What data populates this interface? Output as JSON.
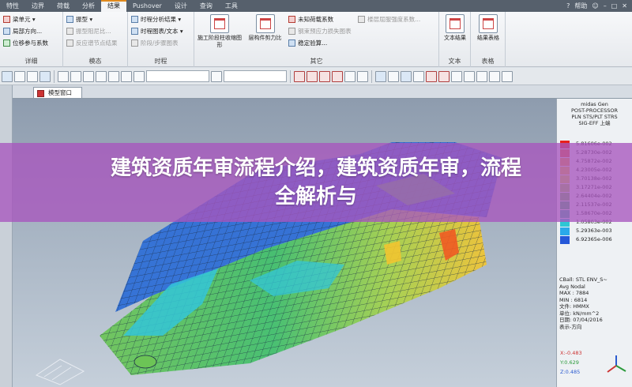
{
  "tabs": [
    "特性",
    "边界",
    "荷载",
    "分析",
    "结果",
    "Pushover",
    "设计",
    "查询",
    "工具"
  ],
  "active_tab": "结果",
  "topbar": {
    "help_label": "帮助",
    "icons": [
      "help-icon",
      "user-icon",
      "minimize-icon",
      "restore-icon",
      "close-icon"
    ]
  },
  "ribbon": {
    "groups": [
      {
        "title": "详细",
        "items": [
          "梁单元 ▾",
          "局部方向...",
          "位移参与系数"
        ]
      },
      {
        "title": "模态",
        "items": [
          "振型 ▾",
          "振型阻尼比...",
          "反应谱节点结果"
        ]
      },
      {
        "title": "时程",
        "items": [
          "时程分析结果 ▾",
          "时程图表/文本 ▾",
          "阶段/步骤图表"
        ]
      },
      {
        "title": "其它",
        "big": [
          "施工阶段柱收缩图形",
          "层构件剪力比"
        ],
        "items": [
          "未知荷载系数",
          "钢束预应力损失图表",
          "稳定验算...",
          "楼层屈服强度系数..."
        ]
      },
      {
        "title": "文本",
        "big": [
          "文本结果"
        ]
      },
      {
        "title": "表格",
        "big": [
          "结果表格"
        ]
      }
    ]
  },
  "model_window": {
    "tab_label": "模型窗口"
  },
  "legend": {
    "header": [
      "midas Gen",
      "POST-PROCESSOR",
      "PLN STS/PLT STRS",
      "SIG-EFF 上端"
    ],
    "entries": [
      {
        "label": "5.81606e-002",
        "color": "#e8201c"
      },
      {
        "label": "5.28730e-002",
        "color": "#f05a22"
      },
      {
        "label": "4.75872e-002",
        "color": "#f59a2a"
      },
      {
        "label": "4.23005e-002",
        "color": "#f2c430"
      },
      {
        "label": "3.70138e-002",
        "color": "#d8d83a"
      },
      {
        "label": "3.17271e-002",
        "color": "#a6d24a"
      },
      {
        "label": "2.64404e-002",
        "color": "#6cc456"
      },
      {
        "label": "2.11537e-002",
        "color": "#3fbf6a"
      },
      {
        "label": "1.58670e-002",
        "color": "#32c0a0"
      },
      {
        "label": "1.05803e-002",
        "color": "#2ec7d4"
      },
      {
        "label": "5.29363e-003",
        "color": "#2aa9ea"
      },
      {
        "label": "6.92365e-006",
        "color": "#2658d8"
      }
    ],
    "info": [
      "CBall: STL ENV_S~",
      "Avg Nodal",
      "MAX : 7884",
      "MIN : 6814",
      "文件: HMMX",
      "单位: kN/mm^2",
      "日期: 07/04/2016",
      "表示-方向"
    ],
    "axis_values": {
      "x": "X:-0.483",
      "y": "Y:0.629",
      "z": "Z:0.485"
    }
  },
  "banner": {
    "line1": "建筑资质年审流程介绍，建筑资质年审，流程",
    "line2": "全解析与"
  },
  "colors": {
    "tabbar": "#56606c",
    "accent": "#e08a1e",
    "banner": "#a856be",
    "model_blue": "#2f6fd6",
    "model_cyan": "#34c6d8",
    "model_green": "#5cc65a"
  }
}
